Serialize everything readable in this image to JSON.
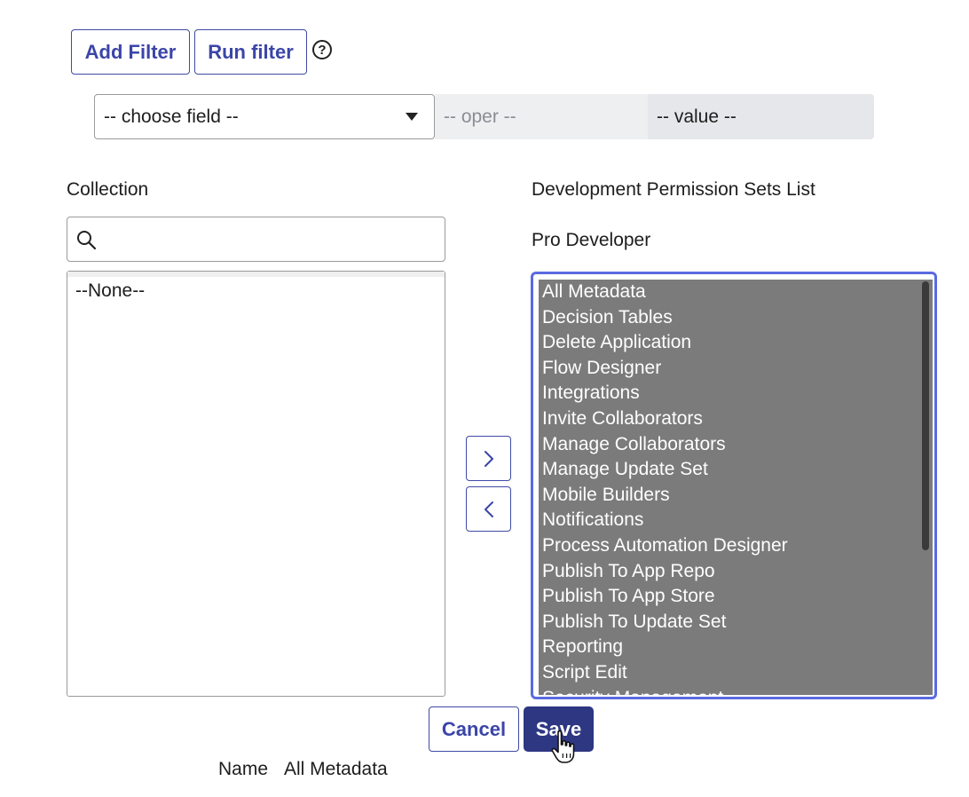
{
  "filter_bar": {
    "add_filter_label": "Add Filter",
    "run_filter_label": "Run filter",
    "help_symbol": "?"
  },
  "condition_row": {
    "field_select_value": "-- choose field --",
    "operator_value": "-- oper --",
    "value_value": "-- value --"
  },
  "collection": {
    "label": "Collection",
    "search_value": "",
    "items": [
      "--None--"
    ]
  },
  "permission_sets": {
    "heading": "Development Permission Sets List",
    "subheading": "Pro Developer",
    "items": [
      "All Metadata",
      "Decision Tables",
      "Delete Application",
      "Flow Designer",
      "Integrations",
      "Invite Collaborators",
      "Manage Collaborators",
      "Manage Update Set",
      "Mobile Builders",
      "Notifications",
      "Process Automation Designer",
      "Publish To App Repo",
      "Publish To App Store",
      "Publish To Update Set",
      "Reporting",
      "Script Edit",
      "Security Management"
    ]
  },
  "transfer": {
    "add_icon": "chevron-right-icon",
    "remove_icon": "chevron-left-icon"
  },
  "actions": {
    "cancel_label": "Cancel",
    "save_label": "Save"
  },
  "name_row": {
    "label": "Name",
    "value": "All Metadata"
  },
  "colors": {
    "accent": "#3b45a8",
    "save_bg": "#2e3782",
    "selected_list_bg": "#7b7b7b",
    "focus_border": "#5b6ae0"
  }
}
